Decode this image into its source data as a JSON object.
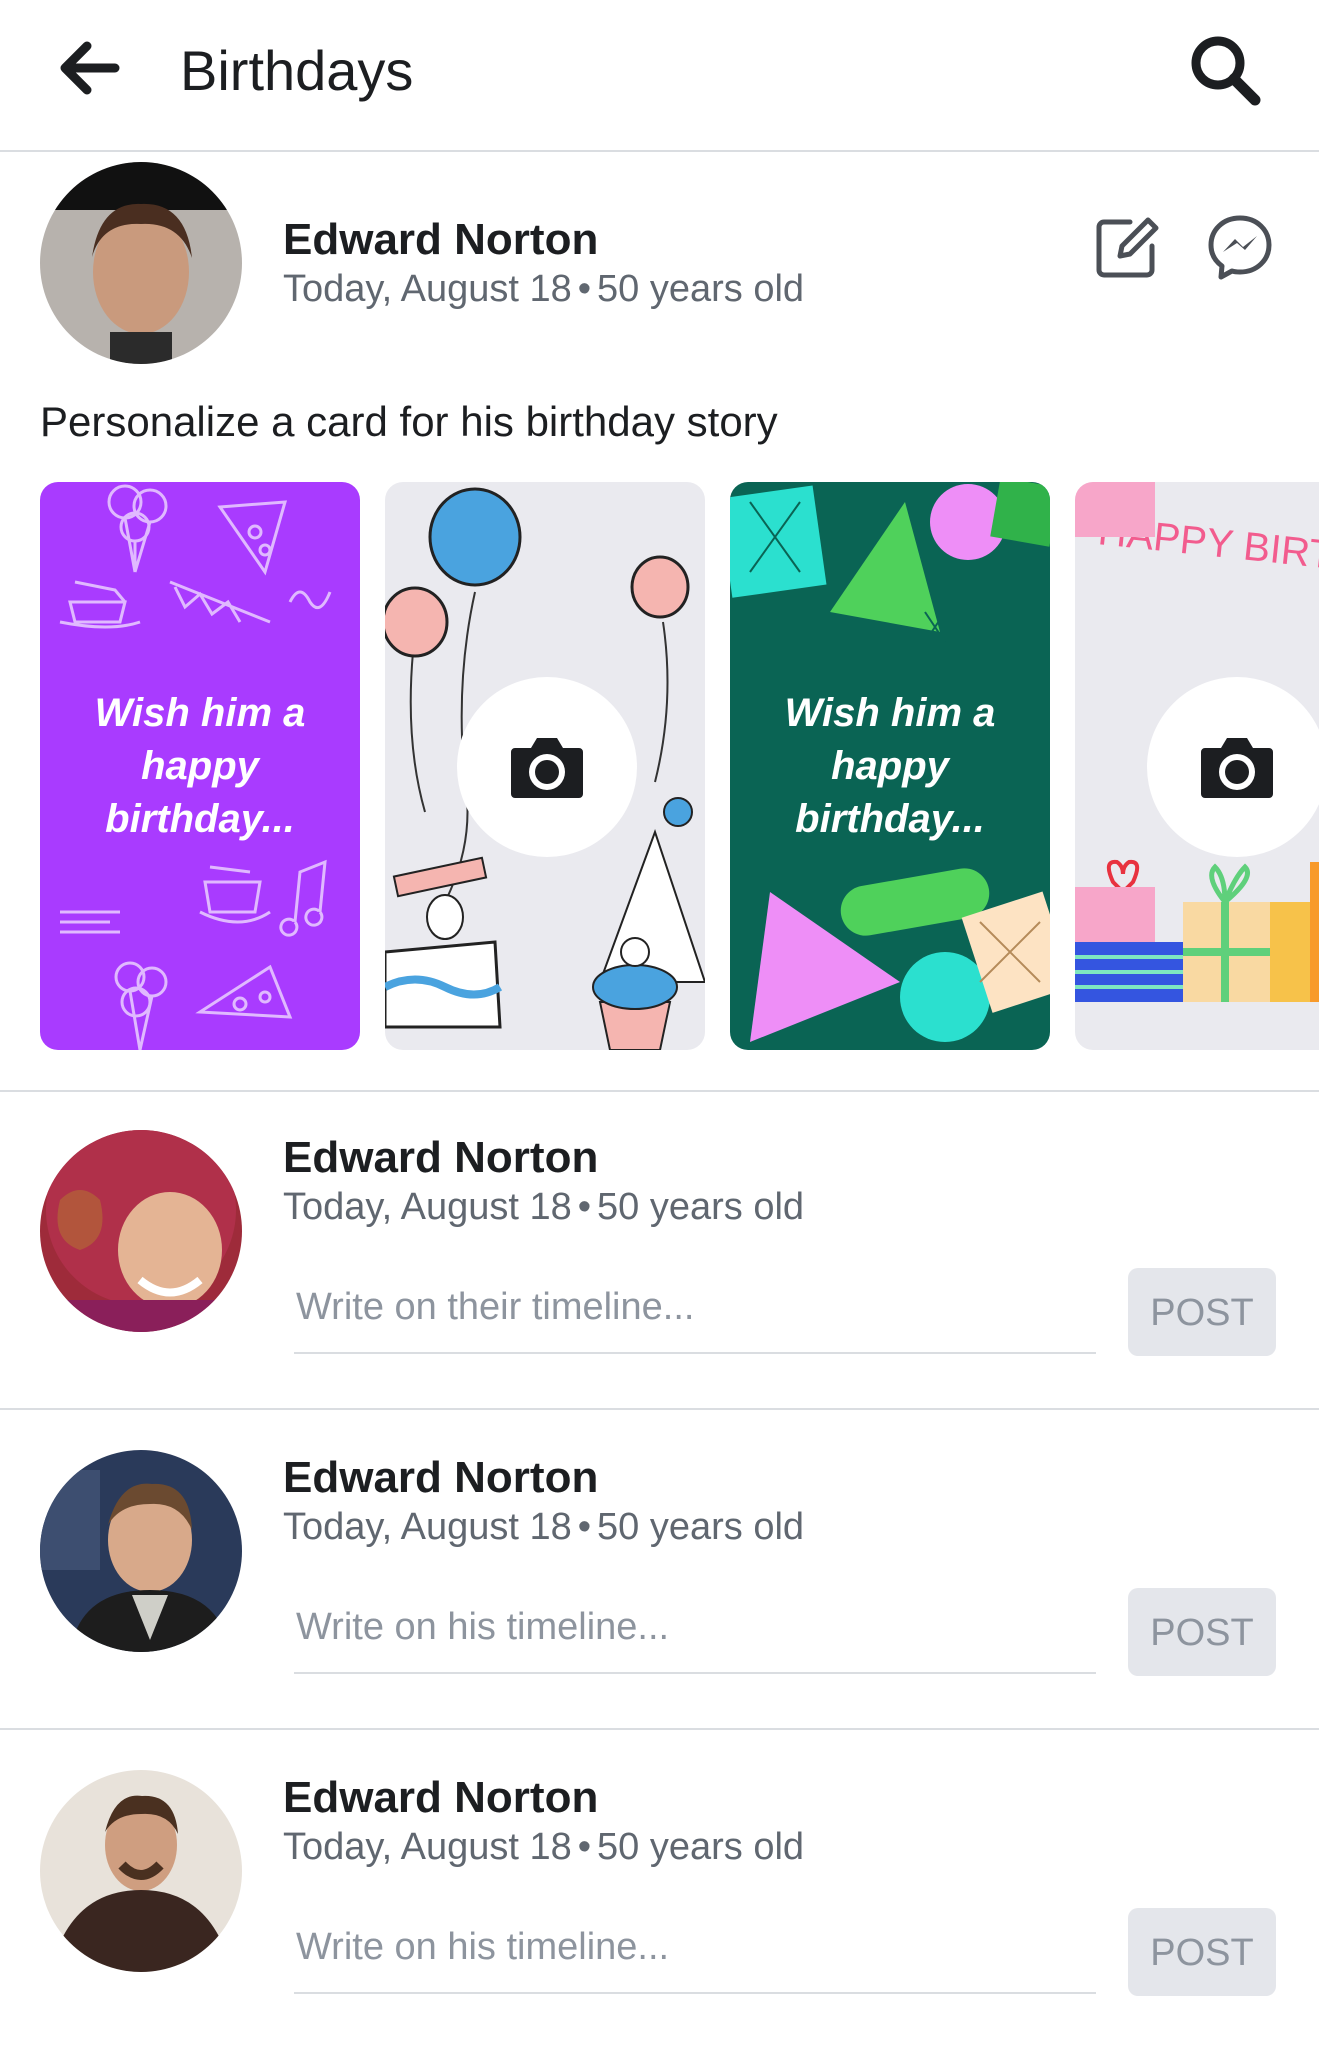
{
  "header": {
    "back_icon": "arrow-left-icon",
    "title": "Birthdays",
    "search_icon": "search-icon"
  },
  "featured": {
    "name": "Edward Norton",
    "date": "Today, August 18",
    "separator": "•",
    "age": "50 years old",
    "edit_icon": "compose-icon",
    "messenger_icon": "messenger-icon",
    "prompt": "Personalize a card for his birthday story",
    "cards": [
      {
        "style": "purple-doodles",
        "text_line1": "Wish him a",
        "text_line2": "happy",
        "text_line3": "birthday...",
        "color": "#a93bff"
      },
      {
        "style": "balloons-camera",
        "camera_icon": "camera-icon",
        "color": "#eaeaef"
      },
      {
        "style": "green-gifts",
        "text_line1": "Wish him a",
        "text_line2": "happy",
        "text_line3": "birthday...",
        "color": "#0a6454"
      },
      {
        "style": "happy-birthday-camera",
        "banner": "HAPPY BIRTH",
        "camera_icon": "camera-icon",
        "color": "#eaeaef"
      }
    ]
  },
  "entries": [
    {
      "name": "Edward Norton",
      "date": "Today, August 18",
      "separator": "•",
      "age": "50 years old",
      "placeholder": "Write on their timeline...",
      "post_label": "POST"
    },
    {
      "name": "Edward Norton",
      "date": "Today, August 18",
      "separator": "•",
      "age": "50 years old",
      "placeholder": "Write on his timeline...",
      "post_label": "POST"
    },
    {
      "name": "Edward Norton",
      "date": "Today, August 18",
      "separator": "•",
      "age": "50 years old",
      "placeholder": "Write on his timeline...",
      "post_label": "POST"
    }
  ],
  "colors": {
    "text_primary": "#1c1e21",
    "text_secondary": "#606770",
    "divider": "#dadde1",
    "button_bg": "#e4e6eb",
    "button_text": "#8d949e"
  }
}
